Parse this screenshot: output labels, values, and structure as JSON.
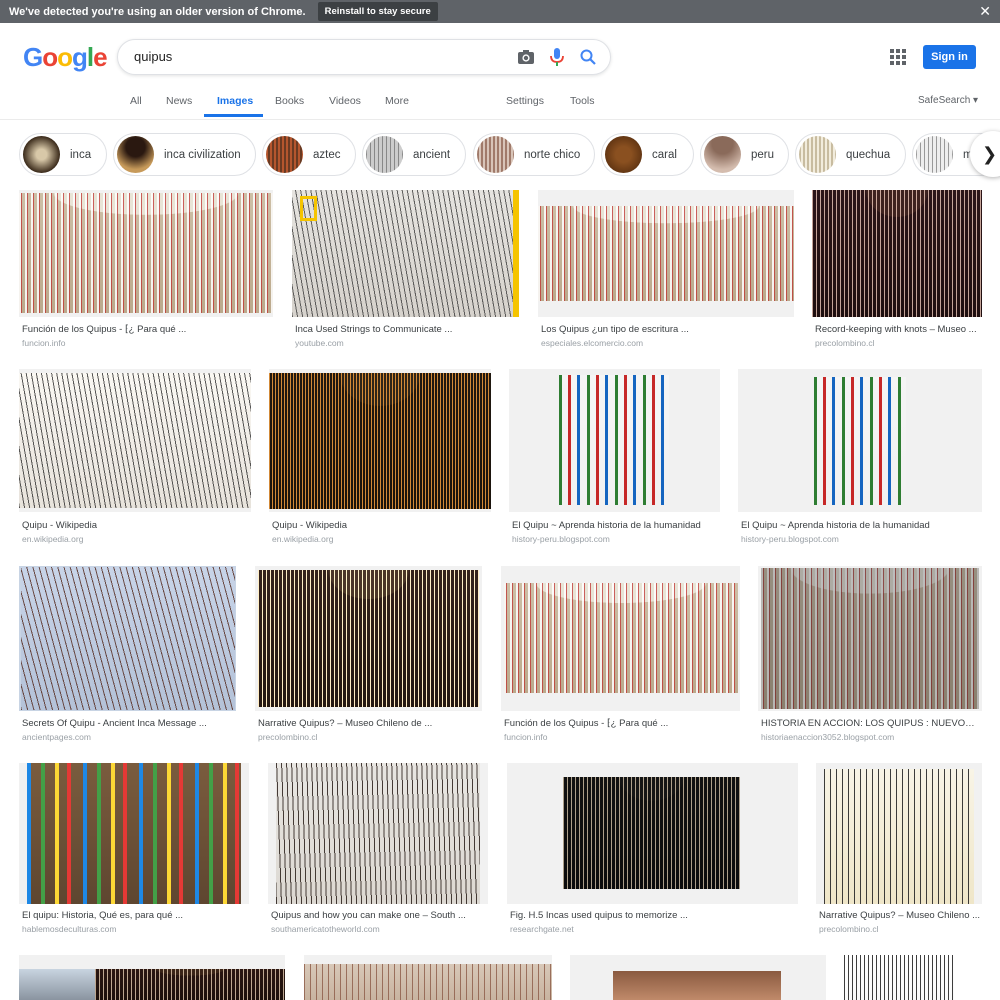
{
  "notification": {
    "message": "We've detected you're using an older version of Chrome.",
    "button": "Reinstall to stay secure",
    "close": "✕"
  },
  "logo": [
    "G",
    "o",
    "o",
    "g",
    "l",
    "e"
  ],
  "search": {
    "query": "quipus"
  },
  "header": {
    "signin": "Sign in"
  },
  "tabs": {
    "all": "All",
    "news": "News",
    "images": "Images",
    "books": "Books",
    "videos": "Videos",
    "more": "More",
    "settings": "Settings",
    "tools": "Tools",
    "safesearch": "SafeSearch ▾"
  },
  "chips": [
    {
      "label": "inca"
    },
    {
      "label": "inca civilization"
    },
    {
      "label": "aztec"
    },
    {
      "label": "ancient"
    },
    {
      "label": "norte chico"
    },
    {
      "label": "caral"
    },
    {
      "label": "peru"
    },
    {
      "label": "quechua"
    },
    {
      "label": "m"
    }
  ],
  "results": [
    {
      "title": "Función de los Quipus - ⁅¿ Para qué ...",
      "source": "funcion.info"
    },
    {
      "title": "Inca Used Strings to Communicate ...",
      "source": "youtube.com"
    },
    {
      "title": "Los Quipus ¿un tipo de escritura ...",
      "source": "especiales.elcomercio.com"
    },
    {
      "title": "Record-keeping with knots – Museo ...",
      "source": "precolombino.cl"
    },
    {
      "title": "Quipu - Wikipedia",
      "source": "en.wikipedia.org"
    },
    {
      "title": "Quipu - Wikipedia",
      "source": "en.wikipedia.org"
    },
    {
      "title": "El Quipu ~ Aprenda historia de la humanidad",
      "source": "history-peru.blogspot.com"
    },
    {
      "title": "El Quipu ~ Aprenda historia de la humanidad",
      "source": "history-peru.blogspot.com"
    },
    {
      "title": "Secrets Of Quipu - Ancient Inca Message ...",
      "source": "ancientpages.com"
    },
    {
      "title": "Narrative Quipus? – Museo Chileno de ...",
      "source": "precolombino.cl"
    },
    {
      "title": "Función de los Quipus - ⁅¿ Para qué ...",
      "source": "funcion.info"
    },
    {
      "title": "HISTORIA EN ACCION: LOS QUIPUS : NUEVOS ...",
      "source": "historiaenaccion3052.blogspot.com"
    },
    {
      "title": "El quipu: Historia, Qué es, para qué ...",
      "source": "hablemosdeculturas.com"
    },
    {
      "title": "Quipus and how you can make one – South ...",
      "source": "southamericatotheworld.com"
    },
    {
      "title": "Fig. H.5 Incas used quipus to memorize ...",
      "source": "researchgate.net"
    },
    {
      "title": "Narrative Quipus? – Museo Chileno ...",
      "source": "precolombino.cl"
    }
  ]
}
